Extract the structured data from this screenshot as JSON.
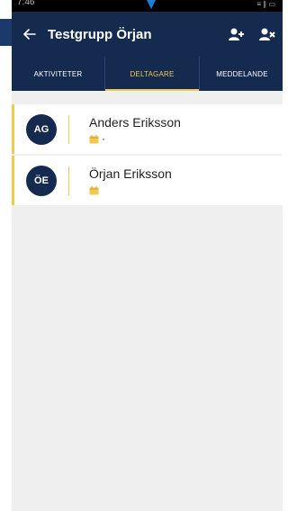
{
  "status_bar": {
    "time": "7:46",
    "system": "≡ ∥ ▭"
  },
  "header": {
    "title": "Testgrupp Örjan",
    "back_icon": "arrow-left-icon",
    "add_member_icon": "person-add-icon",
    "remove_member_icon": "person-remove-icon"
  },
  "tabs": [
    {
      "label": "AKTIVITETER",
      "active": false
    },
    {
      "label": "DELTAGARE",
      "active": true
    },
    {
      "label": "MEDDELANDE",
      "active": false
    }
  ],
  "participants": [
    {
      "initials": "AG",
      "name": "Anders Eriksson"
    },
    {
      "initials": "ÖE",
      "name": "Örjan Eriksson"
    }
  ],
  "colors": {
    "primary": "#152a4f",
    "accent": "#f2c94c",
    "background": "#efefef"
  }
}
